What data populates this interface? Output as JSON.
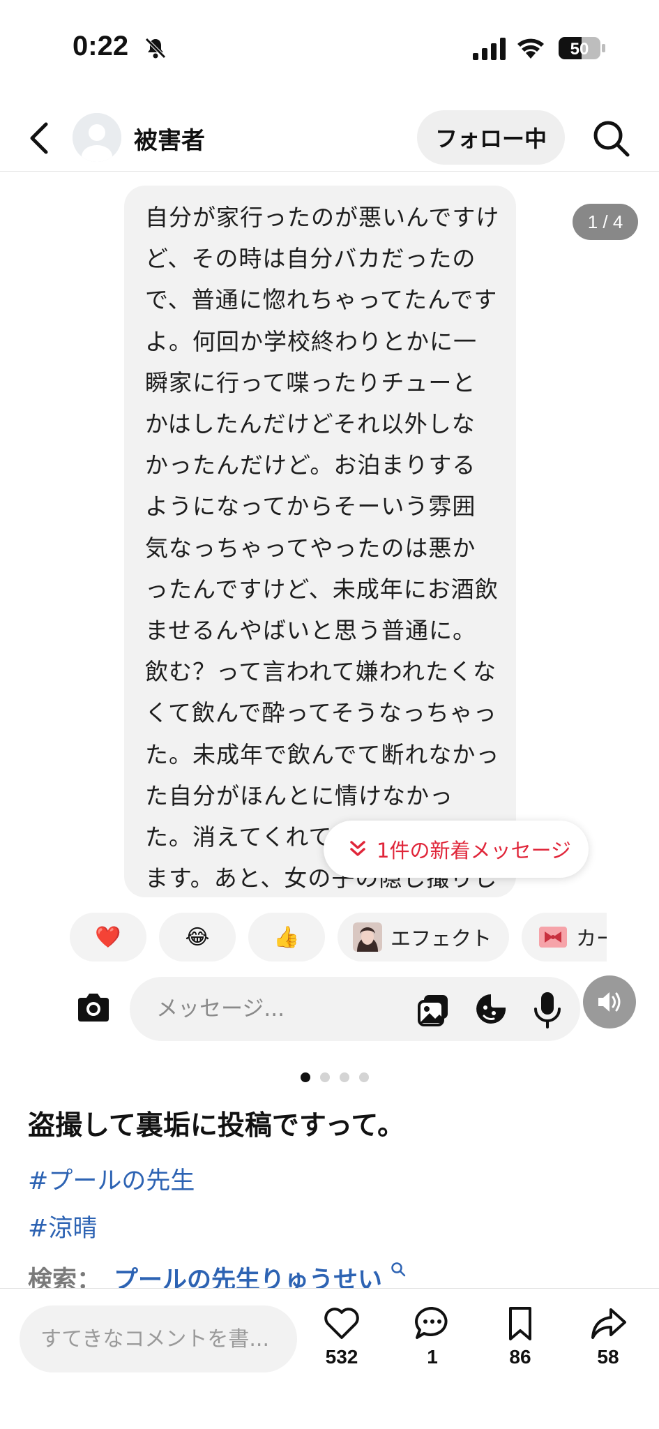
{
  "status_bar": {
    "time": "0:22",
    "battery": "50"
  },
  "header": {
    "username": "被害者",
    "follow_label": "フォロー中"
  },
  "post": {
    "counter": "1 / 4",
    "message_text": "自分が家行ったのが悪いんですけ\nど、その時は自分バカだったの\nで、普通に惚れちゃってたんです\nよ。何回か学校終わりとかに一\n瞬家に行って喋ったりチューと\nかはしたんだけどそれ以外しな\nかったんだけど。お泊まりする\nようになってからそーいう雰囲\n気なっちゃってやったのは悪か\nったんですけど、未成年にお酒飲\nませるんやばいと思う普通に。\n飲む？って言われて嫌われたくな\nくて飲んで酔ってそうなっちゃっ\nた。未成年で飲んでて断れなかっ\nた自分がほんとに情けなかっ\nた。消えてくれて\nます。あと、女の子の隠し撮りし",
    "new_message": "1件の新着メッセージ",
    "reactions": {
      "heart": "❤️",
      "laugh": "😂",
      "thumbs": "👍",
      "effect_label": "エフェクト",
      "card_label": "カー"
    },
    "composer_placeholder": "メッセージ...",
    "page_count": 4,
    "page_index": 0
  },
  "caption": {
    "title": "盗撮して裏垢に投稿ですって。",
    "tags": [
      "#プールの先生",
      "#涼晴"
    ],
    "search_label": "検索：",
    "search_term": "プールの先生りゅうせい"
  },
  "bottom": {
    "comment_placeholder": "すてきなコメントを書...",
    "likes": "532",
    "comments": "1",
    "saves": "86",
    "shares": "58"
  },
  "colors": {
    "accent_red": "#e0263a",
    "link_blue": "#2d63b3"
  }
}
